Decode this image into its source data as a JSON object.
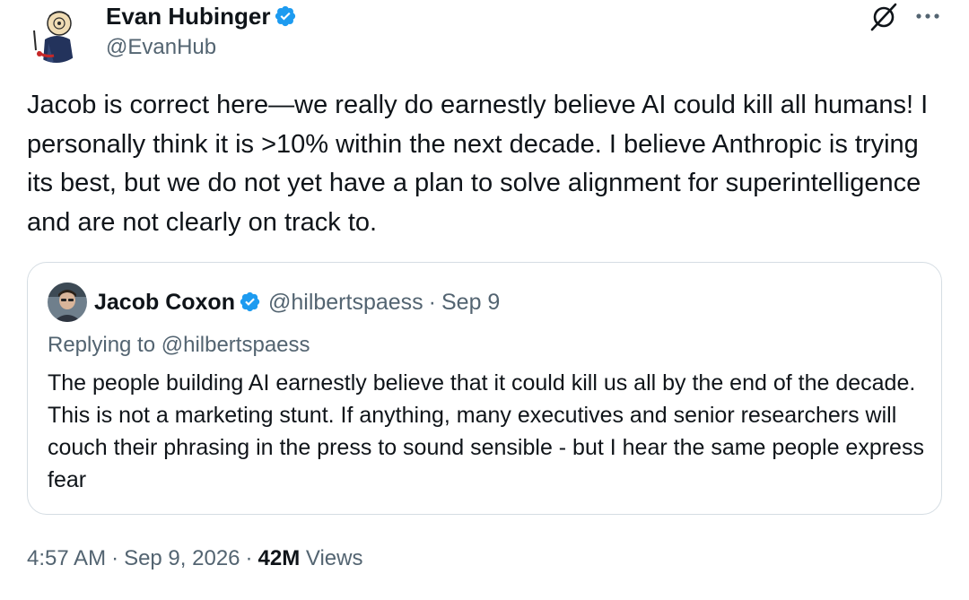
{
  "author": {
    "name": "Evan Hubinger",
    "handle": "@EvanHub",
    "verified": true
  },
  "tweet": {
    "text": "Jacob is correct here—we really do earnestly believe AI could kill all humans! I personally think it is >10% within the next decade. I believe Anthropic is trying its best, but we do not yet have a plan to solve alignment for superintelligence and are not clearly on track to."
  },
  "quote": {
    "name": "Jacob Coxon",
    "handle": "@hilbertspaess",
    "separator": "·",
    "date": "Sep 9",
    "replying_to": "Replying to @hilbertspaess",
    "text": "The people building AI earnestly believe that it could kill us all by the end of the decade. This is not a marketing stunt. If anything, many executives and senior researchers will couch their phrasing in the press to sound sensible - but I hear the same people express fear"
  },
  "footer": {
    "time": "4:57 AM",
    "separator": "·",
    "date": "Sep 9, 2026",
    "views_count": "42M",
    "views_label": "Views"
  },
  "icons": {
    "verified": "verified-badge-icon",
    "grok": "grok-icon",
    "more": "more-icon"
  },
  "colors": {
    "text_primary": "#0f1419",
    "text_secondary": "#536471",
    "verified_blue": "#1d9bf0",
    "border": "#d5dde3"
  }
}
